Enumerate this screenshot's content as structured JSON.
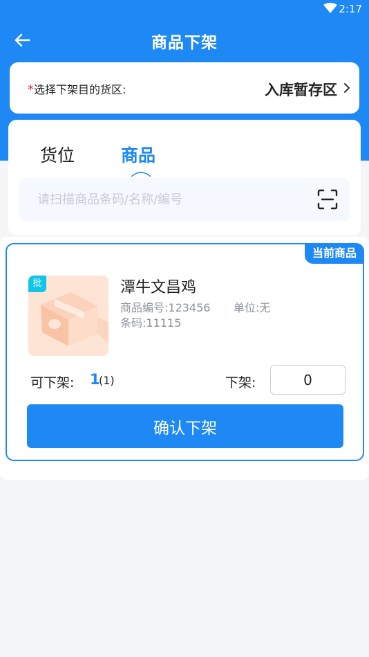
{
  "status_bar": {
    "time": "2:17"
  },
  "nav": {
    "title": "商品下架"
  },
  "target": {
    "required_mark": "*",
    "label": "选择下架目的货区:",
    "value": "入库暂存区"
  },
  "tabs": [
    {
      "label": "货位",
      "active": false
    },
    {
      "label": "商品",
      "active": true
    }
  ],
  "search": {
    "placeholder": "请扫描商品条码/名称/编号",
    "value": ""
  },
  "product": {
    "tag": "当前商品",
    "batch_badge": "批",
    "name": "潭牛文昌鸡",
    "code": "商品编号:123456",
    "unit": "单位:无",
    "barcode": "条码:11115",
    "available_label": "可下架:",
    "available_qty": "1",
    "available_paren": "(1)",
    "offshelf_label": "下架:",
    "offshelf_qty": "0"
  },
  "confirm_button": "确认下架",
  "colors": {
    "primary": "#1e88f5",
    "required": "#f5222d",
    "badge": "#11c5e8",
    "thumb_bg": "#fde4d5"
  },
  "icons": [
    "back-arrow-icon",
    "wifi-icon",
    "chevron-right-icon",
    "scan-icon",
    "package-box-icon"
  ]
}
